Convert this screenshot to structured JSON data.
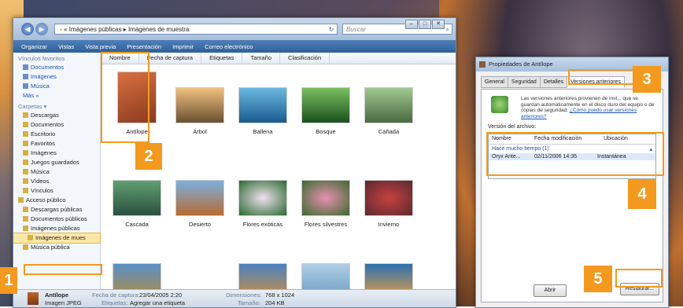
{
  "explorer": {
    "breadcrumb": [
      "Imágenes públicas",
      "Imágenes de muestra"
    ],
    "search_placeholder": "Buscar",
    "toolbar": [
      "Organizar",
      "Vistas",
      "Vista previa",
      "Presentación",
      "Imprimir",
      "Correo electrónico"
    ],
    "columns": [
      "Nombre",
      "Fecha de captura",
      "Etiquetas",
      "Tamaño",
      "Clasificación"
    ],
    "favorites_header": "Vínculos favoritos",
    "favorites": [
      "Documentos",
      "Imágenes",
      "Música",
      "Más »"
    ],
    "folders_header": "Carpetas",
    "folders": [
      "Descargas",
      "Documentos",
      "Escritorio",
      "Favoritos",
      "Imágenes",
      "Juegos guardados",
      "Música",
      "Vídeos",
      "Vínculos",
      "Acceso público",
      "Descargas públicas",
      "Documentos públicos",
      "Imágenes públicas",
      "Imágenes de mues",
      "Música pública"
    ],
    "files_row1": [
      "Antílope",
      "Árbol",
      "Ballena",
      "Bosque",
      "Cañada"
    ],
    "files_row2": [
      "Cascada",
      "Desierto",
      "Flores exóticas",
      "Flores silvestres",
      "Invierno"
    ],
    "status": {
      "name": "Antílope",
      "type": "Imagen JPEG",
      "date_label": "Fecha de captura:",
      "date_value": "23/04/2005 2:20",
      "tags_label": "Etiquetas:",
      "tags_value": "Agregar una etiqueta",
      "dim_label": "Dimensiones:",
      "dim_value": "768 x 1024",
      "size_label": "Tamaño:",
      "size_value": "204 KB"
    }
  },
  "dialog": {
    "title": "Propiedades de Antílope",
    "tabs": [
      "General",
      "Seguridad",
      "Detalles",
      "Versiones anteriores"
    ],
    "info_text": "Las versiones anteriores provienen de inst... que se guardan automáticamente en el disco duro del equipo o de copias de seguridad.",
    "info_link": "¿Cómo puedo usar versiones anteriores?",
    "version_label": "Versión del archivo:",
    "columns": [
      "Nombre",
      "Fecha modificación",
      "Ubicación"
    ],
    "group": "Hace mucho tiempo (1)",
    "row": {
      "name": "Oryx Ante...",
      "date": "02/11/2006 14:35",
      "location": "Instantánea"
    },
    "buttons": [
      "Abrir",
      "Restaurar..."
    ]
  },
  "callouts": [
    "1",
    "2",
    "3",
    "4",
    "5"
  ],
  "colors": {
    "callout": "#f39a1e",
    "toolbar": "#2f5f98",
    "selection": "#fde7a8"
  }
}
